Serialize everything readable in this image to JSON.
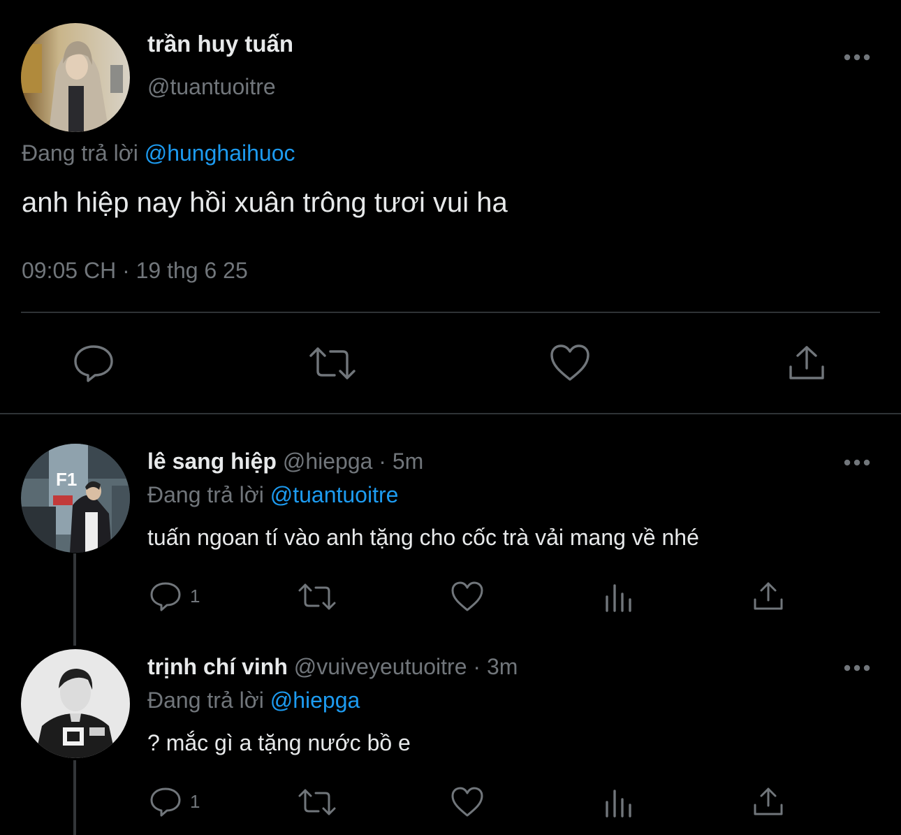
{
  "main_tweet": {
    "name": "trần huy tuấn",
    "handle": "@tuantuoitre",
    "replying_prefix": "Đang trả lời",
    "replying_to": "@hunghaihuoc",
    "text": "anh hiệp nay hồi xuân trông tươi vui ha",
    "timestamp": "09:05 CH · 19 thg 6 25"
  },
  "replies": [
    {
      "name": "lê sang hiệp",
      "meta": "@hiepga · 5m",
      "replying_prefix": "Đang trả lời",
      "replying_to": "@tuantuoitre",
      "text": "tuấn ngoan tí vào anh tặng cho cốc trà vải mang về nhé",
      "reply_count": "1"
    },
    {
      "name": "trịnh chí vinh",
      "meta": "@vuiveyeutuoitre · 3m",
      "replying_prefix": "Đang trả lời",
      "replying_to": "@hiepga",
      "text": "? mắc gì a tặng nước bồ e",
      "reply_count": "1"
    }
  ],
  "colors": {
    "background": "#000000",
    "text": "#e7e9ea",
    "secondary": "#71767b",
    "link": "#1d9bf0",
    "divider": "#2f3336"
  },
  "icons": [
    "more-icon",
    "reply-icon",
    "retweet-icon",
    "like-icon",
    "share-icon",
    "views-icon"
  ]
}
